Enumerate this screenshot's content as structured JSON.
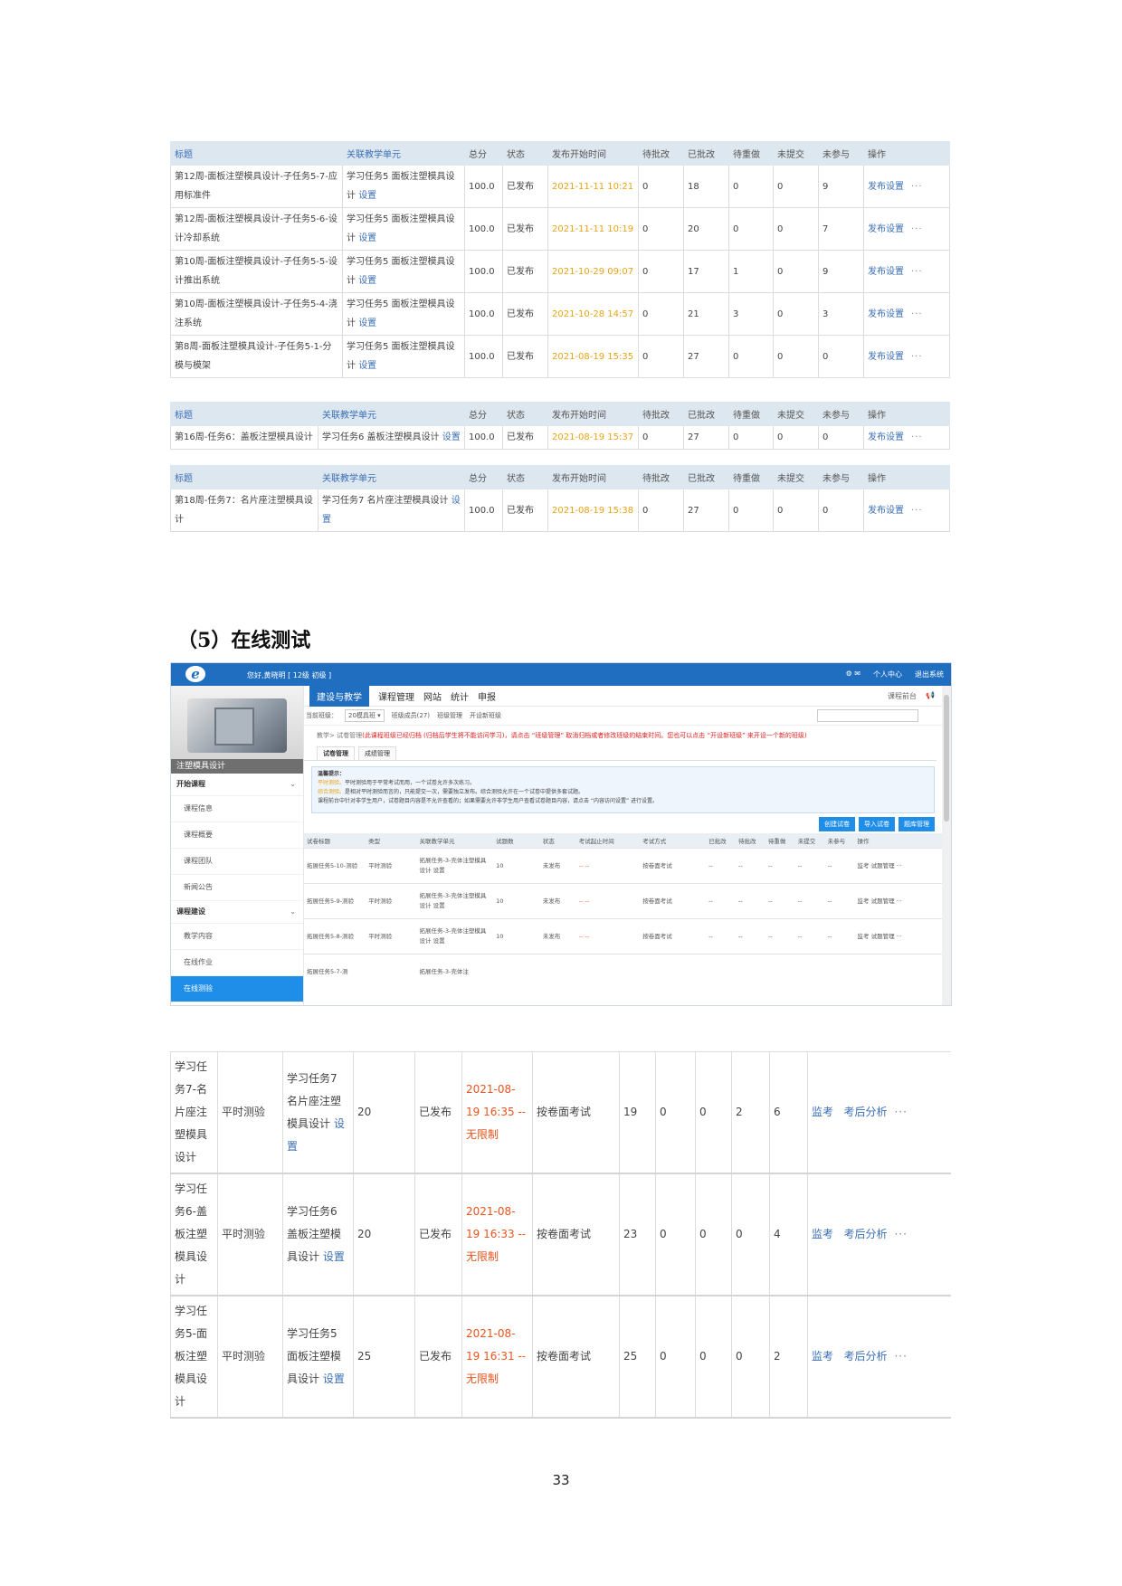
{
  "headers": [
    "标题",
    "关联教学单元",
    "总分",
    "状态",
    "发布开始时间",
    "待批改",
    "已批改",
    "待重做",
    "未提交",
    "未参与",
    "操作"
  ],
  "table1_rows": [
    {
      "title": "第12周-面板注塑模具设计-子任务5-7-应用标准件",
      "unit": "学习任务5 面板注塑模具设计",
      "set": "设置",
      "score": "100.0",
      "status": "已发布",
      "time": "2021-11-11 10:21",
      "a": "0",
      "b": "18",
      "c": "0",
      "d": "0",
      "e": "9",
      "op": "发布设置",
      "more": "···"
    },
    {
      "title": "第12周-面板注塑模具设计-子任务5-6-设计冷却系统",
      "unit": "学习任务5 面板注塑模具设计",
      "set": "设置",
      "score": "100.0",
      "status": "已发布",
      "time": "2021-11-11 10:19",
      "a": "0",
      "b": "20",
      "c": "0",
      "d": "0",
      "e": "7",
      "op": "发布设置",
      "more": "···"
    },
    {
      "title": "第10周-面板注塑模具设计-子任务5-5-设计推出系统",
      "unit": "学习任务5 面板注塑模具设计",
      "set": "设置",
      "score": "100.0",
      "status": "已发布",
      "time": "2021-10-29 09:07",
      "a": "0",
      "b": "17",
      "c": "1",
      "d": "0",
      "e": "9",
      "op": "发布设置",
      "more": "···"
    },
    {
      "title": "第10周-面板注塑模具设计-子任务5-4-浇注系统",
      "unit": "学习任务5 面板注塑模具设计",
      "set": "设置",
      "score": "100.0",
      "status": "已发布",
      "time": "2021-10-28 14:57",
      "a": "0",
      "b": "21",
      "c": "3",
      "d": "0",
      "e": "3",
      "op": "发布设置",
      "more": "···"
    },
    {
      "title": "第8周-面板注塑模具设计-子任务5-1-分模与模架",
      "unit": "学习任务5 面板注塑模具设计",
      "set": "设置",
      "score": "100.0",
      "status": "已发布",
      "time": "2021-08-19 15:35",
      "a": "0",
      "b": "27",
      "c": "0",
      "d": "0",
      "e": "0",
      "op": "发布设置",
      "more": "···"
    }
  ],
  "table2_rows": [
    {
      "title": "第16周-任务6：盖板注塑模具设计",
      "unit": "学习任务6 盖板注塑模具设计",
      "set": "设置",
      "score": "100.0",
      "status": "已发布",
      "time": "2021-08-19 15:37",
      "a": "0",
      "b": "27",
      "c": "0",
      "d": "0",
      "e": "0",
      "op": "发布设置",
      "more": "···"
    }
  ],
  "table3_rows": [
    {
      "title": "第18周-任务7：名片座注塑模具设计",
      "unit": "学习任务7 名片座注塑模具设计",
      "set": "设置",
      "score": "100.0",
      "status": "已发布",
      "time": "2021-08-19 15:38",
      "a": "0",
      "b": "27",
      "c": "0",
      "d": "0",
      "e": "0",
      "op": "发布设置",
      "more": "···"
    }
  ],
  "section_title": "（5）在线测试",
  "app": {
    "logo": "e",
    "hello": "您好,黄晓明 [ 12级 初级 ]",
    "top_right": [
      "个人中心",
      "退出系统"
    ],
    "nav": [
      "建设与教学",
      "课程管理",
      "网站",
      "统计",
      "申报"
    ],
    "nav_right": [
      "课程前台"
    ],
    "sub": {
      "label": "当前班级：",
      "select": "20模具班 ▾",
      "items": [
        "班级成员(27)",
        "班级管理",
        "开设新班级"
      ]
    },
    "crumb": "教学> 试卷管理",
    "crumb_warn": "(此课程班级已经归档 (归档后学生将不能访问学习)，请点击 “班级管理” 取消归档或者修改班级的结束时间。您也可以点击 “开设新班级” 来开设一个新的班级)",
    "tabs": [
      "试卷管理",
      "成绩管理"
    ],
    "tip_title": "温馨提示：",
    "tip_lines": [
      {
        "o": "平时测验。",
        "t": "平时测验用于平常考试而用，一个试卷允许多次练习。"
      },
      {
        "o": "综合测验。",
        "t": "是相对平时测验而言的，只能提交一次，需要独立发布。综合测验允许在一个试卷中提供多套试题。"
      },
      {
        "o": "",
        "t": "课程前台中针对非学生用户，试卷题目内容是不允许查看的；如果需要允许非学生用户查看试卷题目内容，请点击 “内容访问设置” 进行设置。"
      }
    ],
    "buttons": [
      "创建试卷",
      "导入试卷",
      "题库管理"
    ],
    "sidebar_caption": "注塑模具设计",
    "sidebar": [
      {
        "type": "group",
        "label": "开始课程"
      },
      {
        "type": "item",
        "label": "课程信息"
      },
      {
        "type": "item",
        "label": "课程概要"
      },
      {
        "type": "item",
        "label": "课程团队"
      },
      {
        "type": "item",
        "label": "新闻公告"
      },
      {
        "type": "group",
        "label": "课程建设"
      },
      {
        "type": "item",
        "label": "教学内容"
      },
      {
        "type": "item",
        "label": "在线作业"
      },
      {
        "type": "item",
        "label": "在线测验",
        "active": true
      }
    ],
    "inner_headers": [
      "试卷标题",
      "类型",
      "关联教学单元",
      "试题数",
      "状态",
      "考试起止时间",
      "考试方式",
      "已批改",
      "待批改",
      "待重做",
      "未提交",
      "未参与",
      "操作"
    ],
    "inner_rows": [
      {
        "title": "拓展任务5-10-测验",
        "type": "平时测验",
        "unit": "拓展任务-3-壳体注塑模具设计 设置",
        "n": "10",
        "status": "未发布",
        "time": "-- --",
        "mode": "按卷面考试",
        "c1": "--",
        "c2": "--",
        "c3": "--",
        "c4": "--",
        "c5": "--",
        "op": "监考  试题管理  ···"
      },
      {
        "title": "拓展任务5-9-测验",
        "type": "平时测验",
        "unit": "拓展任务-3-壳体注塑模具设计 设置",
        "n": "10",
        "status": "未发布",
        "time": "-- --",
        "mode": "按卷面考试",
        "c1": "--",
        "c2": "--",
        "c3": "--",
        "c4": "--",
        "c5": "--",
        "op": "监考  试题管理  ···"
      },
      {
        "title": "拓展任务5-8-测验",
        "type": "平时测验",
        "unit": "拓展任务-3-壳体注塑模具设计 设置",
        "n": "10",
        "status": "未发布",
        "time": "-- --",
        "mode": "按卷面考试",
        "c1": "--",
        "c2": "--",
        "c3": "--",
        "c4": "--",
        "c5": "--",
        "op": "监考  试题管理  ···"
      },
      {
        "title": "拓展任务5-7-测",
        "type": "",
        "unit": "拓展任务-3-壳体注",
        "n": "",
        "status": "",
        "time": "",
        "mode": "",
        "c1": "",
        "c2": "",
        "c3": "",
        "c4": "",
        "c5": "",
        "op": ""
      }
    ]
  },
  "big_rows": [
    {
      "title": "学习任务7-名片座注塑模具设计",
      "type": "平时测验",
      "unit": "学习任务7 名片座注塑模具设计",
      "set": "设置",
      "n": "20",
      "status": "已发布",
      "time": "2021-08-19 16:35 -- 无限制",
      "mode": "按卷面考试",
      "a": "19",
      "b": "0",
      "c": "0",
      "d": "2",
      "e": "6",
      "op1": "监考",
      "op2": "考后分析",
      "more": "···"
    },
    {
      "title": "学习任务6-盖板注塑模具设计",
      "type": "平时测验",
      "unit": "学习任务6 盖板注塑模具设计",
      "set": "设置",
      "n": "20",
      "status": "已发布",
      "time": "2021-08-19 16:33 -- 无限制",
      "mode": "按卷面考试",
      "a": "23",
      "b": "0",
      "c": "0",
      "d": "0",
      "e": "4",
      "op1": "监考",
      "op2": "考后分析",
      "more": "···"
    },
    {
      "title": "学习任务5-面板注塑模具设计",
      "type": "平时测验",
      "unit": "学习任务5 面板注塑模具设计",
      "set": "设置",
      "n": "25",
      "status": "已发布",
      "time": "2021-08-19 16:31 -- 无限制",
      "mode": "按卷面考试",
      "a": "25",
      "b": "0",
      "c": "0",
      "d": "0",
      "e": "2",
      "op1": "监考",
      "op2": "考后分析",
      "more": "···"
    }
  ],
  "page_number": "33",
  "colors": {
    "header_bg": "#dde7f0",
    "link": "#3b6fb6",
    "date": "#e8a317",
    "accent": "#1f6ec0"
  }
}
